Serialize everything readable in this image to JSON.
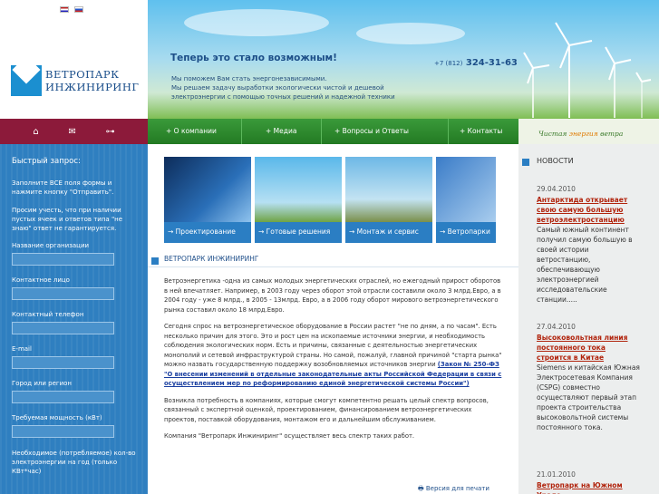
{
  "lang": {
    "en_title": "English",
    "ru_title": "Русский"
  },
  "logo": {
    "line1": "ВЕТРОПАРК",
    "line2": "ИНЖИНИРИНГ"
  },
  "iconbar": {
    "items": [
      "home-icon",
      "mail-icon",
      "sitemap-icon"
    ]
  },
  "quick_request": {
    "title": "Быстрый запрос:",
    "intro": "Заполните ВСЕ поля формы и нажмите кнопку \"Отправить\".",
    "note": "Просим учесть, что при наличии пустых ячеек и ответов типа \"не знаю\" ответ не гарантируется.",
    "fields": [
      {
        "label": "Название организации",
        "value": ""
      },
      {
        "label": "Контактное лицо",
        "value": ""
      },
      {
        "label": "Контактный телефон",
        "value": ""
      },
      {
        "label": "E-mail",
        "value": ""
      },
      {
        "label": "Город или регион",
        "value": ""
      },
      {
        "label": "Требуемая мощность (кВт)",
        "value": ""
      },
      {
        "label": "Необходимое (потребляемое) кол-во электроэнергии на год (только КВт*час)",
        "value": ""
      }
    ]
  },
  "banner": {
    "slogan": "Теперь это стало возможным!",
    "phone_prefix": "+7 (812)",
    "phone": "324-31-63",
    "tagline1": "Мы поможем Вам стать энергонезависимыми.",
    "tagline2": "Мы решаем задачу выработки экологически чистой и дешевой",
    "tagline3": "электроэнергии с помощью точных решений и надежной техники"
  },
  "nav": {
    "items": [
      "О компании",
      "Медиа",
      "Вопросы и Ответы",
      "Контакты"
    ]
  },
  "nav_slogan": {
    "a": "Чистая ",
    "b": "энергия ",
    "c": "ветра"
  },
  "cards": [
    "Проектирование",
    "Готовые решения",
    "Монтаж и сервис",
    "Ветропарки"
  ],
  "section": {
    "title": "ВЕТРОПАРК ИНЖИНИРИНГ"
  },
  "article": {
    "p1": "Ветроэнергетика -одна из самых молодых энергетических отраслей, но ежегодный прирост оборотов в ней впечатляет. Например, в 2003 году через оборот этой отрасли составили около 3 млрд.Евро, а в 2004 году - уже 8 млрд., в 2005 - 13млрд. Евро, а в 2006 году оборот мирового ветроэнергетического рынка составил около 18 млрд.Евро.",
    "p2a": "Сегодня спрос на ветроэнергетическое оборудование в России растет \"не по дням, а по часам\". Есть несколько причин для этого. Это и рост цен на ископаемые источники энергии, и необходимость соблюдения экологических норм. Есть и причины, связанные с деятельностью энергетических монополий и сетевой инфраструктурой страны. Но самой, пожалуй, главной причиной \"старта рынка\" можно назвать государственную поддержку возобновляемых источников энергии ",
    "p2link": "(Закон № 250-ФЗ \"О внесении изменений в отдельные законодательные акты Российской Федерации в связи с осуществлением мер по реформированию единой энергетической системы России\")",
    "p3": "Возникла потребность в компаниях, которые смогут компетентно решать целый спектр вопросов, связанный с экспертной оценкой, проектированием, финансированием ветроэнергетических проектов, поставкой оборудования, монтажом его и дальнейшим обслуживанием.",
    "p4": "Компания \"Ветропарк Инжиниринг\" осуществляет весь спектр таких работ.",
    "print": "Версия для печати"
  },
  "news": {
    "title": "НОВОСТИ",
    "items": [
      {
        "date": "29.04.2010",
        "title": "Антарктида открывает свою самую большую ветроэлектростанцию",
        "text": "Самый южный континент получил самую большую в своей истории ветростанцию, обеспечивающую электроэнергией исследовательские станции....."
      },
      {
        "date": "27.04.2010",
        "title": "Высоковольтная линия постоянного тока строится в Китае",
        "text": "Siemens и китайская Южная Электросетевая Компания (CSPG) совместно осуществляют первый этап проекта строительства высоковольтной системы постоянного тока."
      },
      {
        "date": "21.01.2010",
        "title": "Ветропарк на Южном Урале",
        "text": ""
      }
    ]
  }
}
